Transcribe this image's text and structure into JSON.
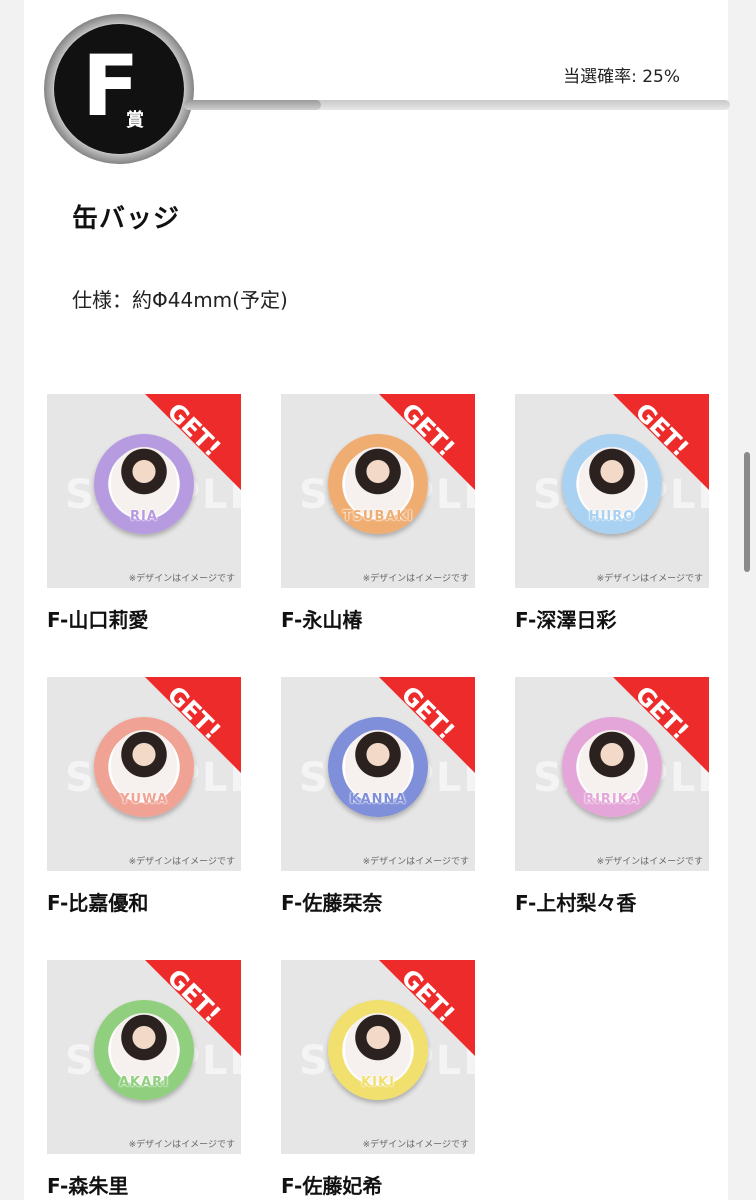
{
  "prize": {
    "letter": "F",
    "kanji": "賞",
    "rate_label": "当選確率: 25%",
    "rate_value": 25,
    "title": "缶バッジ",
    "spec": "仕様：約Φ44mm(予定)"
  },
  "item_common": {
    "ribbon": "GET!",
    "watermark": "SAMPLE",
    "note": "※デザインはイメージです"
  },
  "items": [
    {
      "name": "F-山口莉愛",
      "badge_text": "RIA",
      "color": "#b79be0"
    },
    {
      "name": "F-永山椿",
      "badge_text": "TSUBAKI",
      "color": "#f0ad72"
    },
    {
      "name": "F-深澤日彩",
      "badge_text": "HIIRO",
      "color": "#a9d1f2"
    },
    {
      "name": "F-比嘉優和",
      "badge_text": "YUWA",
      "color": "#f0a394"
    },
    {
      "name": "F-佐藤栞奈",
      "badge_text": "KANNA",
      "color": "#7f8fd9"
    },
    {
      "name": "F-上村梨々香",
      "badge_text": "RIRIKA",
      "color": "#e4a6d8"
    },
    {
      "name": "F-森朱里",
      "badge_text": "AKARI",
      "color": "#8fcf7e"
    },
    {
      "name": "F-佐藤妃希",
      "badge_text": "KIKI",
      "color": "#f1df6e"
    }
  ],
  "colors": {
    "ribbon": "#ee2b2b",
    "badge_black": "#111111"
  }
}
